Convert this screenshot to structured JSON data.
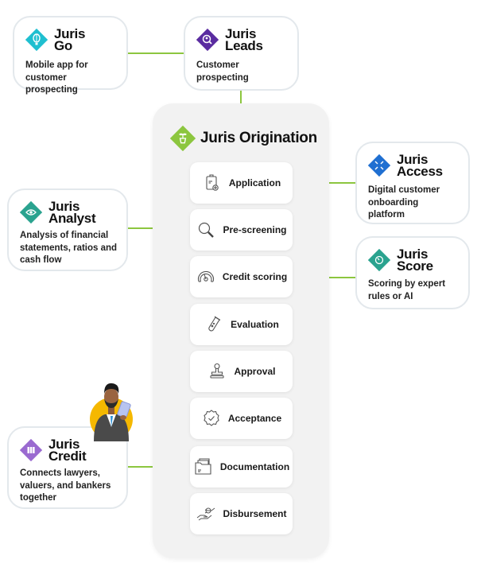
{
  "colors": {
    "connector": "#8cc63f",
    "go": "#1fbfd0",
    "leads": "#5a2ca0",
    "origination": "#8cc63f",
    "access": "#1f6fd1",
    "analyst": "#2aa38f",
    "score": "#2aa38f",
    "credit": "#9a6ad0"
  },
  "products": {
    "go": {
      "brand_line1": "Juris",
      "brand_line2": "Go",
      "description": "Mobile app for customer prospecting",
      "icon": "hot-air-balloon-icon"
    },
    "leads": {
      "brand_line1": "Juris",
      "brand_line2": "Leads",
      "description": "Customer prospecting",
      "icon": "search-person-icon"
    },
    "access": {
      "brand_line1": "Juris",
      "brand_line2": "Access",
      "description": "Digital customer onboarding platform",
      "icon": "arrows-in-icon"
    },
    "analyst": {
      "brand_line1": "Juris",
      "brand_line2": "Analyst",
      "description": "Analysis of financial statements, ratios and cash flow",
      "icon": "eye-icon"
    },
    "score": {
      "brand_line1": "Juris",
      "brand_line2": "Score",
      "description": "Scoring by expert rules or AI",
      "icon": "gauge-icon"
    },
    "credit": {
      "brand_line1": "Juris",
      "brand_line2": "Credit",
      "description": "Connects lawyers, valuers, and bankers together",
      "icon": "binders-icon"
    }
  },
  "origination": {
    "title": "Juris Origination",
    "icon": "plant-pot-icon",
    "steps": [
      {
        "label": "Application",
        "icon": "clipboard-icon"
      },
      {
        "label": "Pre-screening",
        "icon": "magnifier-icon"
      },
      {
        "label": "Credit scoring",
        "icon": "gauge-icon"
      },
      {
        "label": "Evaluation",
        "icon": "test-tube-icon"
      },
      {
        "label": "Approval",
        "icon": "stamp-icon"
      },
      {
        "label": "Acceptance",
        "icon": "badge-check-icon"
      },
      {
        "label": "Documentation",
        "icon": "folder-icon"
      },
      {
        "label": "Disbursement",
        "icon": "hand-coin-icon"
      }
    ]
  }
}
